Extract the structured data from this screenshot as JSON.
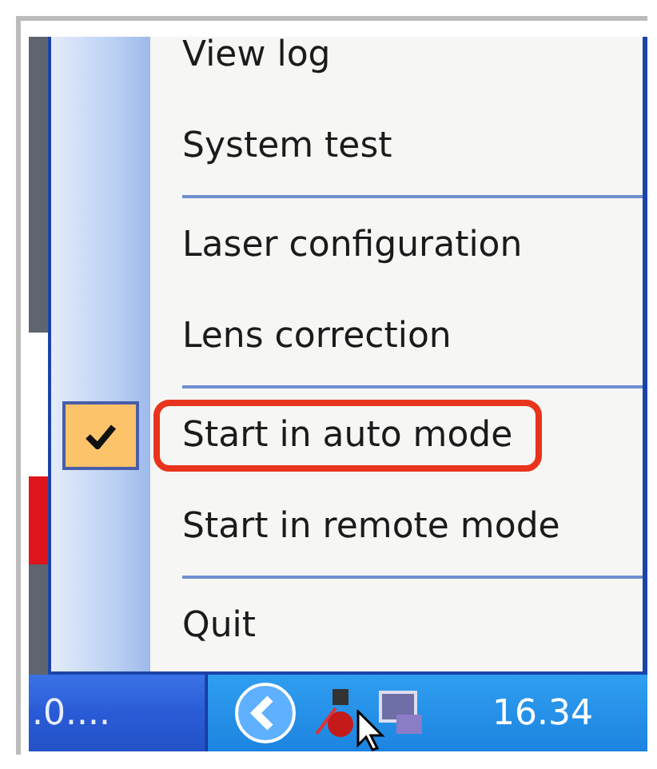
{
  "menu": {
    "items": [
      {
        "kind": "item",
        "label": "View log",
        "checked": false,
        "highlighted": false
      },
      {
        "kind": "item",
        "label": "System test",
        "checked": false,
        "highlighted": false
      },
      {
        "kind": "separator"
      },
      {
        "kind": "item",
        "label": "Laser configuration",
        "checked": false,
        "highlighted": false
      },
      {
        "kind": "item",
        "label": "Lens correction",
        "checked": false,
        "highlighted": false
      },
      {
        "kind": "separator"
      },
      {
        "kind": "item",
        "label": "Start in auto mode",
        "checked": true,
        "highlighted": true
      },
      {
        "kind": "item",
        "label": "Start in remote mode",
        "checked": false,
        "highlighted": false
      },
      {
        "kind": "separator"
      },
      {
        "kind": "item",
        "label": "Quit",
        "checked": false,
        "highlighted": false
      }
    ]
  },
  "taskbar": {
    "task_label": ".0....",
    "clock": "16.34"
  }
}
